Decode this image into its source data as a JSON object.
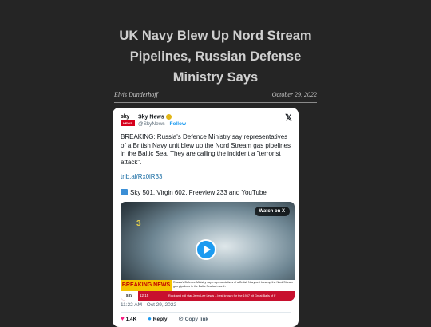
{
  "article": {
    "title_line1": "UK Navy Blew Up Nord Stream",
    "title_line2": "Pipelines, Russian Defense",
    "title_line3": "Ministry Says",
    "author": "Elvis Dunderhoff",
    "date": "October 29, 2022"
  },
  "tweet": {
    "account_name": "Sky News",
    "handle": "@SkyNews",
    "follow_label": "Follow",
    "logo_top": "sky",
    "logo_bottom": "NEWS",
    "text": "BREAKING: Russia's Defence Ministry say representatives of a British Navy unit blew up the Nord Stream gas pipelines in the Baltic Sea. They are calling the incident a \"terrorist attack\".",
    "link": "trib.al/Rx0iR33",
    "tv_text": "Sky 501, Virgin 602, Freeview 233 and YouTube",
    "timestamp": "11:22 AM · Oct 29, 2022",
    "likes": "1.4K",
    "reply_label": "Reply",
    "copy_link_label": "Copy link"
  },
  "video": {
    "watch_label": "Watch on X",
    "breaking_label": "BREAKING NEWS",
    "headline": "Russia's Defence Ministry says representatives of a British Navy unit blew up the Nord Stream gas pipelines in the Baltic Sea last month",
    "sky_logo": "sky news",
    "time": "12:15",
    "ticker": "Rock and roll star Jerry Lee Lewis – best known for the 1957 hit Great Balls of F"
  },
  "icons": {
    "x": "x-logo-icon",
    "verified": "verified-badge-icon",
    "tv": "tv-icon",
    "heart": "heart-icon",
    "reply": "reply-icon",
    "link": "link-icon",
    "play": "play-icon"
  },
  "colors": {
    "background": "#252525",
    "link": "#1d9bf0",
    "heart": "#f91880",
    "breaking": "#f6c400",
    "sky_red": "#d6001c"
  }
}
